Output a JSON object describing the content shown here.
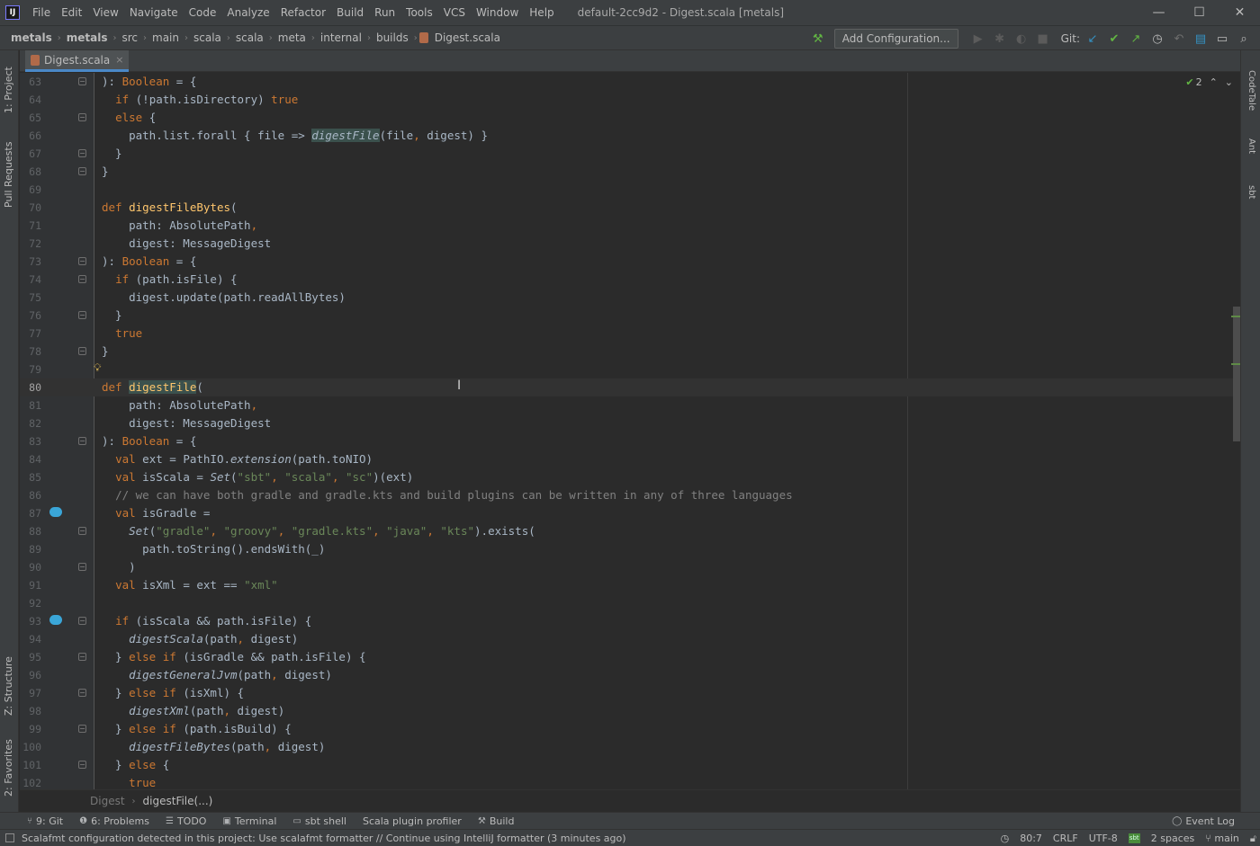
{
  "window": {
    "logo": "IJ",
    "title": "default-2cc9d2 - Digest.scala [metals]",
    "controls": {
      "minimize": "—",
      "maximize": "☐",
      "close": "✕"
    }
  },
  "menu": [
    "File",
    "Edit",
    "View",
    "Navigate",
    "Code",
    "Analyze",
    "Refactor",
    "Build",
    "Run",
    "Tools",
    "VCS",
    "Window",
    "Help"
  ],
  "breadcrumbs": [
    "metals",
    "metals",
    "src",
    "main",
    "scala",
    "scala",
    "meta",
    "internal",
    "builds",
    "Digest.scala"
  ],
  "toolbar": {
    "add_configuration": "Add Configuration...",
    "git_label": "Git:"
  },
  "left_tabs": [
    "1: Project",
    "Pull Requests",
    "Z: Structure",
    "2: Favorites"
  ],
  "right_tabs": [
    "CodeTale",
    "Ant",
    "sbt"
  ],
  "editor_tab": {
    "label": "Digest.scala",
    "close": "×"
  },
  "inspection": {
    "count": "2"
  },
  "code": {
    "lines": [
      {
        "n": "63",
        "html": "): <span class=\"kw\">Boolean</span> = {"
      },
      {
        "n": "64",
        "html": "  <span class=\"kw\">if</span> (!path.isDirectory) <span class=\"kw\">true</span>"
      },
      {
        "n": "65",
        "html": "  <span class=\"kw\">else</span> {"
      },
      {
        "n": "66",
        "html": "    path.list.forall { file => <span class=\"it hl\">digestFile</span>(file<span class=\"kw\">,</span> digest) }"
      },
      {
        "n": "67",
        "html": "  }"
      },
      {
        "n": "68",
        "html": "}"
      },
      {
        "n": "69",
        "html": ""
      },
      {
        "n": "70",
        "html": "<span class=\"kw\">def</span> <span class=\"fn\">digestFileBytes</span>("
      },
      {
        "n": "71",
        "html": "    path: AbsolutePath<span class=\"kw\">,</span>"
      },
      {
        "n": "72",
        "html": "    digest: MessageDigest"
      },
      {
        "n": "73",
        "html": "): <span class=\"kw\">Boolean</span> = {"
      },
      {
        "n": "74",
        "html": "  <span class=\"kw\">if</span> (path.isFile) {"
      },
      {
        "n": "75",
        "html": "    digest.update(path.readAllBytes)"
      },
      {
        "n": "76",
        "html": "  }"
      },
      {
        "n": "77",
        "html": "  <span class=\"kw\">true</span>"
      },
      {
        "n": "78",
        "html": "}"
      },
      {
        "n": "79",
        "html": ""
      },
      {
        "n": "80",
        "html": "<span class=\"kw\">def</span> <span class=\"fn hl\">digestFile</span>("
      },
      {
        "n": "81",
        "html": "    path: AbsolutePath<span class=\"kw\">,</span>"
      },
      {
        "n": "82",
        "html": "    digest: MessageDigest"
      },
      {
        "n": "83",
        "html": "): <span class=\"kw\">Boolean</span> = {"
      },
      {
        "n": "84",
        "html": "  <span class=\"kw\">val</span> ext = PathIO.<span class=\"it\">extension</span>(path.toNIO)"
      },
      {
        "n": "85",
        "html": "  <span class=\"kw\">val</span> isScala = <span class=\"it\">Set</span>(<span class=\"st\">\"sbt\"</span><span class=\"kw\">,</span> <span class=\"st\">\"scala\"</span><span class=\"kw\">,</span> <span class=\"st\">\"sc\"</span>)(ext)"
      },
      {
        "n": "86",
        "html": "  <span class=\"cm\">// we can have both gradle and gradle.kts and build plugins can be written in any of three languages</span>"
      },
      {
        "n": "87",
        "html": "  <span class=\"kw\">val</span> isGradle ="
      },
      {
        "n": "88",
        "html": "    <span class=\"it\">Set</span>(<span class=\"st\">\"gradle\"</span><span class=\"kw\">,</span> <span class=\"st\">\"groovy\"</span><span class=\"kw\">,</span> <span class=\"st\">\"gradle.kts\"</span><span class=\"kw\">,</span> <span class=\"st\">\"java\"</span><span class=\"kw\">,</span> <span class=\"st\">\"kts\"</span>).exists("
      },
      {
        "n": "89",
        "html": "      path.toString().endsWith(_)"
      },
      {
        "n": "90",
        "html": "    )"
      },
      {
        "n": "91",
        "html": "  <span class=\"kw\">val</span> isXml = ext == <span class=\"st\">\"xml\"</span>"
      },
      {
        "n": "92",
        "html": ""
      },
      {
        "n": "93",
        "html": "  <span class=\"kw\">if</span> (isScala && path.isFile) {"
      },
      {
        "n": "94",
        "html": "    <span class=\"it\">digestScala</span>(path<span class=\"kw\">,</span> digest)"
      },
      {
        "n": "95",
        "html": "  } <span class=\"kw\">else if</span> (isGradle && path.isFile) {"
      },
      {
        "n": "96",
        "html": "    <span class=\"it\">digestGeneralJvm</span>(path<span class=\"kw\">,</span> digest)"
      },
      {
        "n": "97",
        "html": "  } <span class=\"kw\">else if</span> (isXml) {"
      },
      {
        "n": "98",
        "html": "    <span class=\"it\">digestXml</span>(path<span class=\"kw\">,</span> digest)"
      },
      {
        "n": "99",
        "html": "  } <span class=\"kw\">else if</span> (path.isBuild) {"
      },
      {
        "n": "100",
        "html": "    <span class=\"it\">digestFileBytes</span>(path<span class=\"kw\">,</span> digest)"
      },
      {
        "n": "101",
        "html": "  } <span class=\"kw\">else</span> {"
      },
      {
        "n": "102",
        "html": "    <span class=\"kw\">true</span>"
      }
    ]
  },
  "editor_breadcrumbs": {
    "class": "Digest",
    "method": "digestFile(...)"
  },
  "bottom_tools": [
    {
      "icon": "git-icon",
      "glyph": "⑂",
      "label": "9: Git"
    },
    {
      "icon": "problems-icon",
      "glyph": "❶",
      "label": "6: Problems"
    },
    {
      "icon": "todo-icon",
      "glyph": "☰",
      "label": "TODO"
    },
    {
      "icon": "terminal-icon",
      "glyph": "▣",
      "label": "Terminal"
    },
    {
      "icon": "sbt-shell-icon",
      "glyph": "▭",
      "label": "sbt shell"
    },
    {
      "icon": "",
      "glyph": "",
      "label": "Scala plugin profiler"
    },
    {
      "icon": "build-icon",
      "glyph": "⚒",
      "label": "Build"
    }
  ],
  "event_log": "Event Log",
  "status": {
    "message": "Scalafmt configuration detected in this project: Use scalafmt formatter // Continue using IntelliJ formatter (3 minutes ago)",
    "position": "80:7",
    "line_sep": "CRLF",
    "encoding": "UTF-8",
    "sbt_badge": "sbt",
    "indent": "2 spaces",
    "branch": "main"
  },
  "colors": {
    "accent": "#4a88c7",
    "keyword": "#cc7832",
    "function": "#ffc66d",
    "string": "#6a8759",
    "comment": "#808080"
  }
}
